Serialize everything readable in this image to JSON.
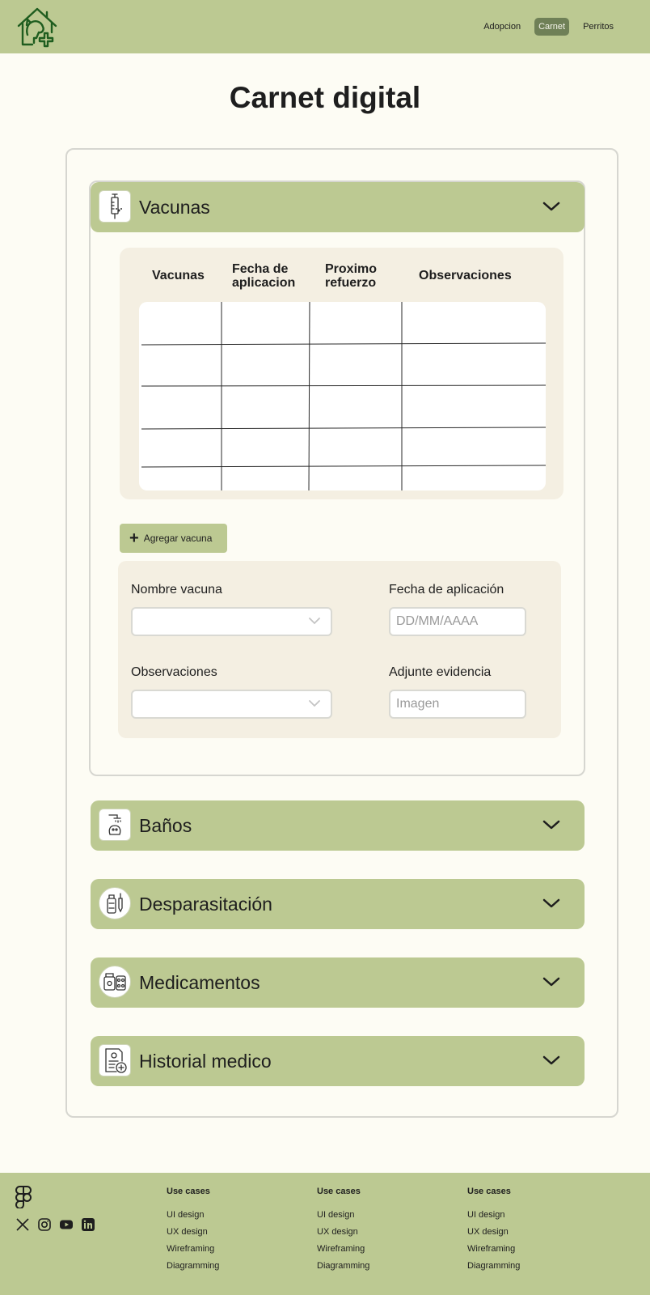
{
  "nav": {
    "items": [
      {
        "label": "Adopcion",
        "active": false
      },
      {
        "label": "Carnet",
        "active": true
      },
      {
        "label": "Perritos",
        "active": false
      }
    ]
  },
  "page": {
    "title": "Carnet digital"
  },
  "accordion": {
    "vacunas": {
      "label": "Vacunas",
      "expanded": true
    },
    "banos": {
      "label": "Baños",
      "expanded": false
    },
    "desparasitacion": {
      "label": "Desparasitación",
      "expanded": false
    },
    "medicamentos": {
      "label": "Medicamentos",
      "expanded": false
    },
    "historial": {
      "label": "Historial medico",
      "expanded": false
    }
  },
  "table": {
    "headers": [
      "Vacunas",
      "Fecha de aplicacion",
      "Proximo refuerzo",
      "Observaciones"
    ]
  },
  "add_button": {
    "label": "Agregar vacuna"
  },
  "form": {
    "nombre_label": "Nombre vacuna",
    "nombre_value": "",
    "fecha_label": "Fecha de aplicación",
    "fecha_placeholder": "DD/MM/AAAA",
    "observaciones_label": "Observaciones",
    "observaciones_value": "",
    "evidencia_label": "Adjunte evidencia",
    "evidencia_placeholder": "Imagen"
  },
  "footer": {
    "columns": [
      {
        "title": "Use cases",
        "links": [
          "UI design",
          "UX design",
          "Wireframing",
          "Diagramming"
        ]
      },
      {
        "title": "Use cases",
        "links": [
          "UI design",
          "UX design",
          "Wireframing",
          "Diagramming"
        ]
      },
      {
        "title": "Use cases",
        "links": [
          "UI design",
          "UX design",
          "Wireframing",
          "Diagramming"
        ]
      }
    ]
  },
  "colors": {
    "brand_green": "#bcc992",
    "active_nav": "#6f8057",
    "logo_green": "#1f5d1f",
    "panel_beige": "#f4efe2"
  }
}
